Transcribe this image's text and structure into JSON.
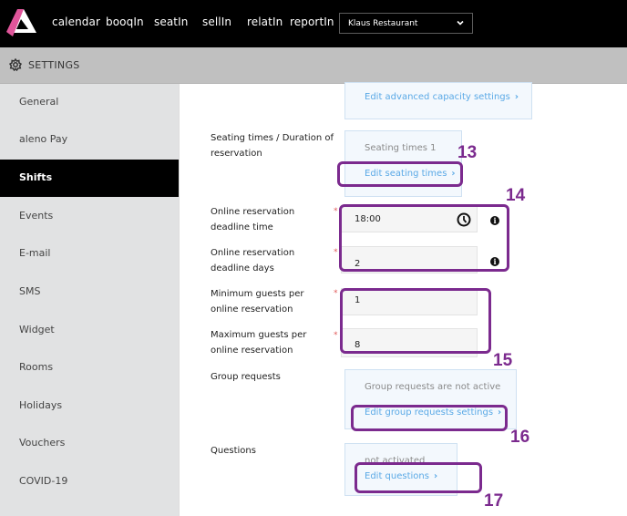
{
  "topbar": {
    "logo": "aleno-logo-icon",
    "nav": [
      "calendar",
      "booqIn",
      "seatIn",
      "sellIn",
      "relatIn",
      "reportIn"
    ],
    "venue_select": "Klaus Restaurant"
  },
  "settings_bar": {
    "title": "SETTINGS",
    "icon": "gear-icon"
  },
  "sidebar": {
    "items": [
      {
        "label": "General",
        "active": false
      },
      {
        "label": "aleno Pay",
        "active": false
      },
      {
        "label": "Shifts",
        "active": true
      },
      {
        "label": "Events",
        "active": false
      },
      {
        "label": "E-mail",
        "active": false
      },
      {
        "label": "SMS",
        "active": false
      },
      {
        "label": "Widget",
        "active": false
      },
      {
        "label": "Rooms",
        "active": false
      },
      {
        "label": "Holidays",
        "active": false
      },
      {
        "label": "Vouchers",
        "active": false
      },
      {
        "label": "COVID-19",
        "active": false
      }
    ]
  },
  "main": {
    "advanced_capacity_link": "Edit advanced capacity settings",
    "seating": {
      "label": "Seating times / Duration of reservation",
      "status": "Seating times 1",
      "link": "Edit seating times"
    },
    "deadline_time": {
      "label": "Online reservation deadline time",
      "value": "18:00",
      "icon": "clock-icon"
    },
    "deadline_days": {
      "label": "Online reservation deadline days",
      "value": "2"
    },
    "min_guests": {
      "label": "Minimum guests per online reservation",
      "value": "1"
    },
    "max_guests": {
      "label": "Maximum guests per online reservation",
      "value": "8"
    },
    "group_requests": {
      "label": "Group requests",
      "status": "Group requests are not active",
      "link": "Edit group requests settings"
    },
    "questions": {
      "label": "Questions",
      "status": "not activated",
      "link": "Edit questions"
    },
    "required_marker": "*",
    "arrow": "›"
  },
  "annotations": {
    "color": "#7b2a8e",
    "numbers": [
      "13",
      "14",
      "15",
      "16",
      "17"
    ]
  }
}
